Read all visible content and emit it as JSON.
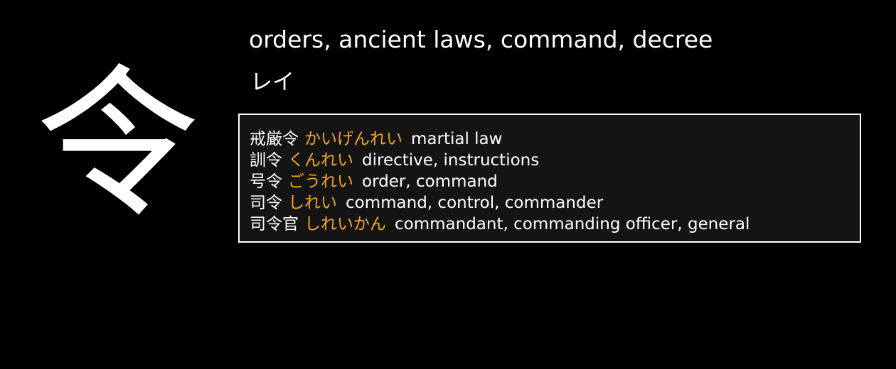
{
  "kanji": {
    "character": "令",
    "meaning": "orders, ancient laws, command, decree",
    "reading": "レイ"
  },
  "examples": [
    {
      "word": "戒厳令",
      "kana": "かいげんれい",
      "gloss": "martial law"
    },
    {
      "word": "訓令",
      "kana": "くんれい",
      "gloss": "directive, instructions"
    },
    {
      "word": "号令",
      "kana": "ごうれい",
      "gloss": "order, command"
    },
    {
      "word": "司令",
      "kana": "しれい",
      "gloss": "command, control, commander"
    },
    {
      "word": "司令官",
      "kana": "しれいかん",
      "gloss": "commandant, commanding officer, general"
    }
  ],
  "colors": {
    "background": "#000000",
    "panel": "#141414",
    "text": "#ffffff",
    "kana_accent": "#f5a623"
  }
}
